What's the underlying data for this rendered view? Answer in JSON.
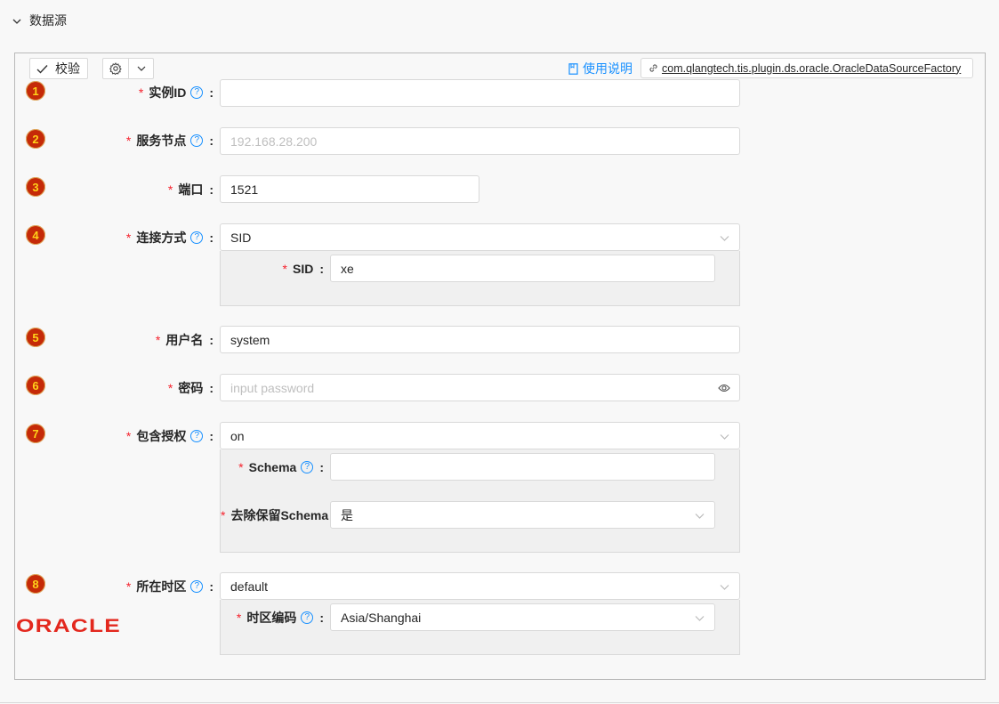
{
  "section": {
    "title": "数据源",
    "chevron_icon": "chevron-down-icon"
  },
  "toolbar": {
    "validate_label": "校验",
    "settings_icon": "gear-icon",
    "dropdown_icon": "chevron-down-icon",
    "doc_link": "使用说明",
    "plugin_id": "com.qlangtech.tis.plugin.ds.oracle.OracleDataSourceFactory"
  },
  "colors": {
    "accent": "#1890ff",
    "required": "#f5222d",
    "badge_bg": "#c52a08",
    "badge_fg": "#ffd21a",
    "oracle_red": "#e3281e"
  },
  "fields": {
    "instance_id": {
      "badge": "1",
      "label": "实例ID",
      "value": ""
    },
    "service_node": {
      "badge": "2",
      "label": "服务节点",
      "placeholder": "192.168.28.200"
    },
    "port": {
      "badge": "3",
      "label": "端口",
      "value": "1521"
    },
    "conn_mode": {
      "badge": "4",
      "label": "连接方式",
      "value": "SID",
      "sub": {
        "sid_label": "SID",
        "sid_value": "xe"
      }
    },
    "username": {
      "badge": "5",
      "label": "用户名",
      "value": "system"
    },
    "password": {
      "badge": "6",
      "label": "密码",
      "placeholder": "input password"
    },
    "auth": {
      "badge": "7",
      "label": "包含授权",
      "value": "on",
      "sub": {
        "schema_label": "Schema",
        "schema_value": "",
        "strip_label": "去除保留Schema",
        "strip_value": "是"
      }
    },
    "timezone": {
      "badge": "8",
      "label": "所在时区",
      "value": "default",
      "sub": {
        "tz_code_label": "时区编码",
        "tz_code_value": "Asia/Shanghai"
      }
    }
  },
  "logo": {
    "text": "ORACLE"
  }
}
